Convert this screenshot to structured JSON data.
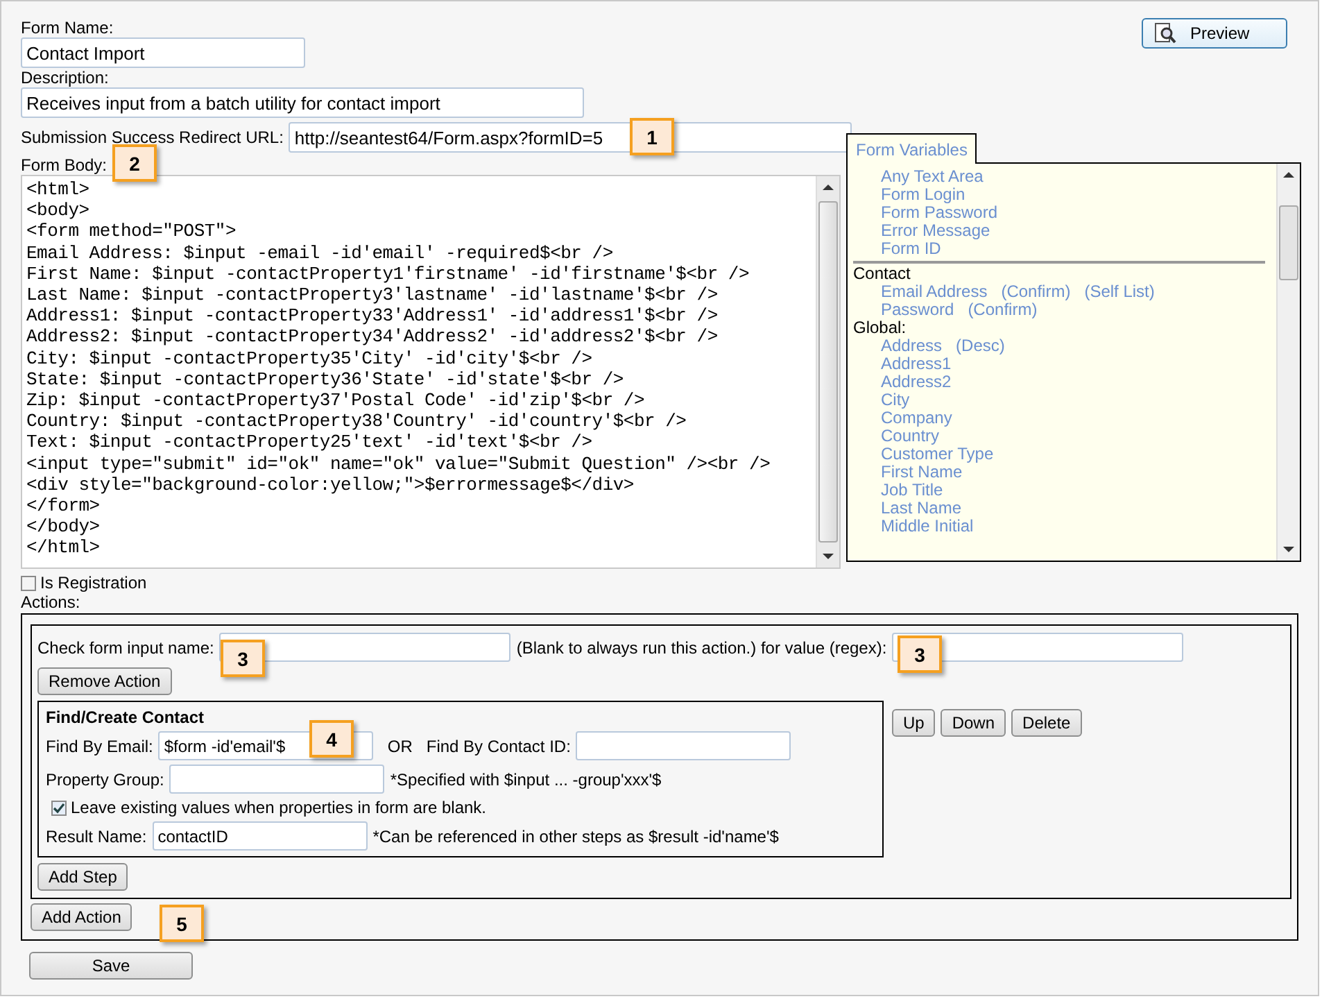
{
  "form_name": {
    "label": "Form Name:",
    "value": "Contact Import"
  },
  "description": {
    "label": "Description:",
    "value": "Receives input from a batch utility for contact import"
  },
  "redirect": {
    "label": "Submission Success Redirect URL:",
    "value": "http://seantest64/Form.aspx?formID=5"
  },
  "preview_button": "Preview",
  "form_body": {
    "label": "Form Body:",
    "lines": [
      "<html>",
      "<body>",
      "<form method=\"POST\">",
      "Email Address: $input -email -id'email' -required$<br />",
      "First Name: $input -contactProperty1'firstname' -id'firstname'$<br />",
      "Last Name: $input -contactProperty3'lastname' -id'lastname'$<br />",
      "Address1: $input -contactProperty33'Address1' -id'address1'$<br />",
      "Address2: $input -contactProperty34'Address2' -id'address2'$<br />",
      "City: $input -contactProperty35'City' -id'city'$<br />",
      "State: $input -contactProperty36'State' -id'state'$<br />",
      "Zip: $input -contactProperty37'Postal Code' -id'zip'$<br />",
      "Country: $input -contactProperty38'Country' -id'country'$<br />",
      "Text: $input -contactProperty25'text' -id'text'$<br />",
      "<input type=\"submit\" id=\"ok\" name=\"ok\" value=\"Submit Question\" /><br />",
      "<div style=\"background-color:yellow;\">$errormessage$</div>",
      "</form>",
      "</body>",
      "</html>"
    ]
  },
  "variables": {
    "tab": "Form Variables",
    "groups": [
      {
        "items": [
          {
            "label": "Any Text Area"
          },
          {
            "label": "Form Login"
          },
          {
            "label": "Form Password"
          },
          {
            "label": "Error Message"
          },
          {
            "label": "Form ID"
          }
        ]
      },
      {
        "heading": "Contact",
        "items": [
          {
            "label": "Email Address",
            "extras": [
              "(Confirm)",
              "(Self List)"
            ]
          },
          {
            "label": "Password",
            "extras": [
              "(Confirm)"
            ]
          }
        ]
      },
      {
        "heading": "Global:",
        "items": [
          {
            "label": "Address",
            "extras": [
              "(Desc)"
            ]
          },
          {
            "label": "Address1"
          },
          {
            "label": "Address2"
          },
          {
            "label": "City"
          },
          {
            "label": "Company"
          },
          {
            "label": "Country"
          },
          {
            "label": "Customer Type"
          },
          {
            "label": "First Name"
          },
          {
            "label": "Job Title"
          },
          {
            "label": "Last Name"
          },
          {
            "label": "Middle Initial"
          }
        ]
      }
    ]
  },
  "is_registration": {
    "label": "Is Registration",
    "checked": false
  },
  "actions_label": "Actions:",
  "action": {
    "check_label": "Check form input name:",
    "check_hint": "(Blank to always run this action.) for value (regex):",
    "remove_button": "Remove Action",
    "step": {
      "title": "Find/Create Contact",
      "email_label": "Find By Email:",
      "email_value": "$form -id'email'$",
      "or": "OR",
      "contact_id_label": "Find By Contact ID:",
      "group_label": "Property Group:",
      "group_hint": "*Specified with $input ... -group'xxx'$",
      "leave_label": "Leave existing values when properties in form are blank.",
      "leave_checked": true,
      "result_label": "Result Name:",
      "result_value": "contactID",
      "result_hint": "*Can be referenced in other steps as $result -id'name'$"
    },
    "step_buttons": [
      "Up",
      "Down",
      "Delete"
    ],
    "add_step": "Add Step"
  },
  "add_action": "Add Action",
  "save": "Save",
  "callouts": [
    "1",
    "2",
    "3",
    "3",
    "4",
    "5"
  ]
}
